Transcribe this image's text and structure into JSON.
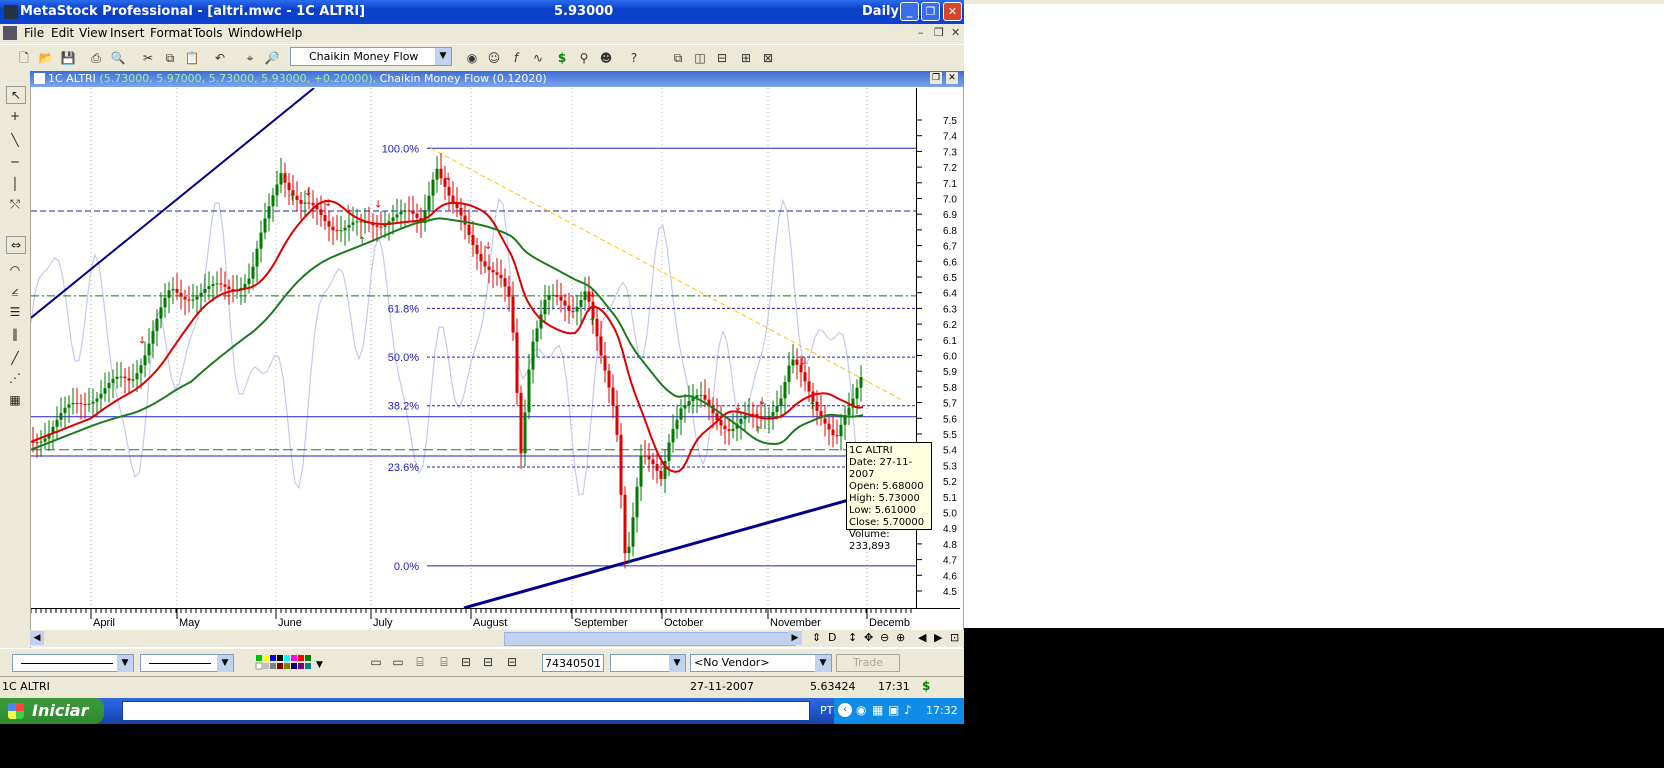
{
  "window": {
    "title": "MetaStock Professional - [altri.mwc - 1C ALTRI]",
    "price": "5.93000",
    "period": "Daily"
  },
  "menu": [
    "File",
    "Edit",
    "View",
    "Insert",
    "Format",
    "Tools",
    "Window",
    "Help"
  ],
  "toolbar": {
    "indicator_select": "Chaikin Money Flow"
  },
  "chart_header": {
    "symbol": "1C ALTRI",
    "ohlc": "(5.73000, 5.97000, 5.73000, 5.93000, +0.20000),",
    "indicator": "Chaikin Money Flow (0.12020)"
  },
  "chart_data": {
    "type": "candlestick",
    "y_ticks": [
      "7.5",
      "7.4",
      "7.3",
      "7.2",
      "7.1",
      "7.0",
      "6.9",
      "6.8",
      "6.7",
      "6.6",
      "6.5",
      "6.4",
      "6.3",
      "6.2",
      "6.1",
      "6.0",
      "5.9",
      "5.8",
      "5.7",
      "5.6",
      "5.5",
      "5.4",
      "5.3",
      "5.2",
      "5.1",
      "5.0",
      "4.9",
      "4.8",
      "4.7",
      "4.6",
      "4.5"
    ],
    "ylim": [
      4.4,
      7.6
    ],
    "x_labels": [
      "April",
      "May",
      "June",
      "July",
      "August",
      "September",
      "October",
      "November",
      "Decemb"
    ],
    "fib_levels": [
      {
        "label": "100.0%",
        "price": 7.32
      },
      {
        "label": "61.8%",
        "price": 6.3
      },
      {
        "label": "50.0%",
        "price": 5.99
      },
      {
        "label": "38.2%",
        "price": 5.68
      },
      {
        "label": "23.6%",
        "price": 5.29
      },
      {
        "label": "0.0%",
        "price": 4.66
      }
    ],
    "colors": {
      "up": "#007a00",
      "down": "#e00000",
      "ma_short": "#e00000",
      "ma_long": "#1e7a1e",
      "trendline": "#00008b",
      "fib": "#2020c0",
      "downtrend": "#ffc800",
      "cmf": "#c8c8f0"
    }
  },
  "tooltip": {
    "lines": [
      "1C ALTRI",
      "Date: 27-11-2007",
      "Open: 5.68000",
      "High: 5.73000",
      "Low: 5.61000",
      "Close: 5.70000",
      "Volume: 233,893"
    ]
  },
  "bottom_toolbar": {
    "field_value": "74340501",
    "vendor": "<No Vendor>",
    "trade": "Trade"
  },
  "status": {
    "symbol": "1C ALTRI",
    "date": "27-11-2007",
    "value": "5.63424",
    "time": "17:31",
    "dollar": "$"
  },
  "taskbar": {
    "start": "Iniciar",
    "lang": "PT",
    "clock": "17:32"
  }
}
